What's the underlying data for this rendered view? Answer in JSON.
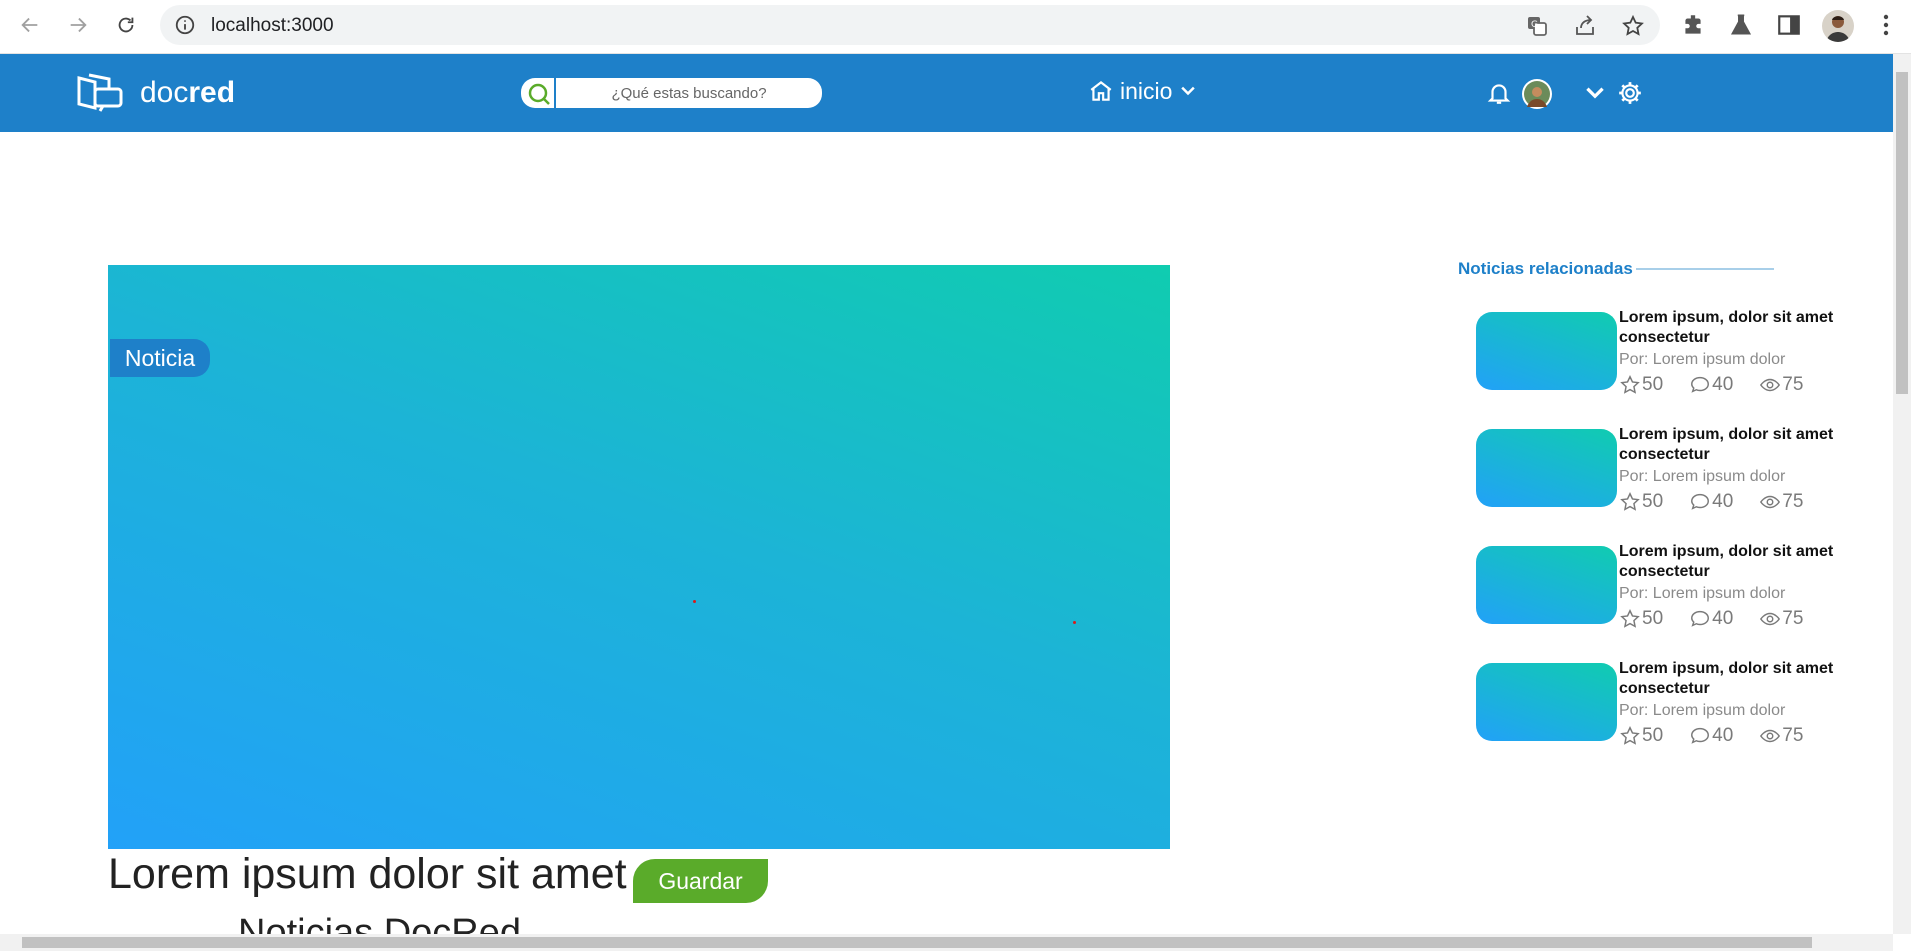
{
  "browser": {
    "url": "localhost:3000",
    "icons": [
      "back-icon",
      "forward-icon",
      "reload-icon",
      "info-icon",
      "translate-icon",
      "share-icon",
      "bookmark-star-icon",
      "extensions-icon",
      "labs-icon",
      "side-panel-icon",
      "profile-avatar",
      "more-menu-icon"
    ]
  },
  "header": {
    "brand_light": "doc",
    "brand_bold": "red",
    "search_placeholder": "¿Qué estas buscando?",
    "nav_label": "inicio",
    "color": "#1e80c9"
  },
  "article": {
    "badge": "Noticia",
    "title": "Lorem ipsum dolor sit amet",
    "save_label": "Guardar",
    "subtitle": "Noticias DocRed",
    "hero_gradient": [
      "#10ccb0",
      "#22a1f8"
    ],
    "save_color": "#5aab2a"
  },
  "related": {
    "heading": "Noticias relacionadas",
    "items": [
      {
        "title": "Lorem ipsum, dolor sit amet consectetur",
        "author": "Por: Lorem ipsum dolor",
        "stars": "50",
        "comments": "40",
        "views": "75"
      },
      {
        "title": "Lorem ipsum, dolor sit amet consectetur",
        "author": "Por: Lorem ipsum dolor",
        "stars": "50",
        "comments": "40",
        "views": "75"
      },
      {
        "title": "Lorem ipsum, dolor sit amet consectetur",
        "author": "Por: Lorem ipsum dolor",
        "stars": "50",
        "comments": "40",
        "views": "75"
      },
      {
        "title": "Lorem ipsum, dolor sit amet consectetur",
        "author": "Por: Lorem ipsum dolor",
        "stars": "50",
        "comments": "40",
        "views": "75"
      }
    ]
  }
}
